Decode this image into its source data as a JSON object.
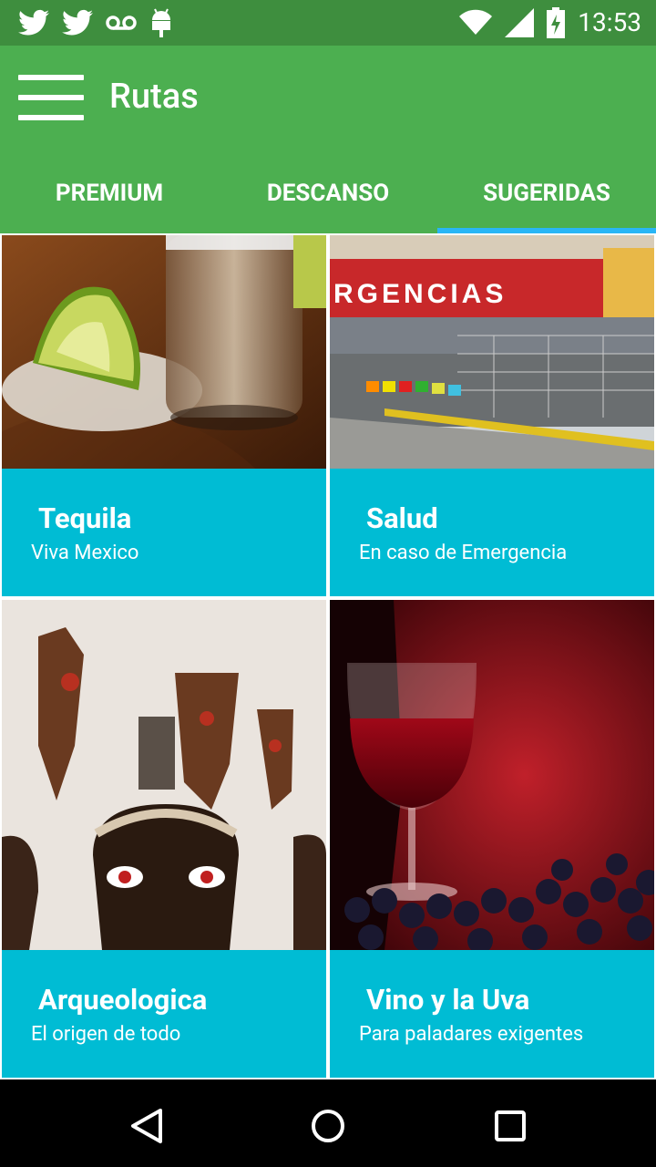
{
  "status_bar": {
    "time": "13:53",
    "icons": [
      "twitter-icon",
      "twitter-icon",
      "voicemail-icon",
      "android-icon",
      "wifi-icon",
      "signal-icon",
      "battery-charging-icon"
    ]
  },
  "app_bar": {
    "title": "Rutas",
    "menu_icon": "hamburger-menu-icon",
    "background_color": "#4caf50",
    "status_color": "#3e8e3e"
  },
  "tabs": [
    {
      "label": "PREMIUM",
      "active": false
    },
    {
      "label": "DESCANSO",
      "active": false
    },
    {
      "label": "SUGERIDAS",
      "active": true
    }
  ],
  "tab_indicator_color": "#29b6f6",
  "cards": [
    {
      "title": "Tequila",
      "subtitle": "Viva Mexico",
      "image": "tequila-shot-lime-salt"
    },
    {
      "title": "Salud",
      "subtitle": "En caso de Emergencia",
      "image": "hospital-emergency-entrance"
    },
    {
      "title": "Arqueologica",
      "subtitle": "El origen de todo",
      "image": "mexican-masks"
    },
    {
      "title": "Vino y la Uva",
      "subtitle": "Para paladares exigentes",
      "image": "red-wine-glass-grapes"
    }
  ],
  "card_color": "#00bcd4",
  "hospital_sign_text": "RGENCIAS",
  "nav_bar": {
    "icons": [
      "back-icon",
      "home-icon",
      "recents-icon"
    ]
  }
}
